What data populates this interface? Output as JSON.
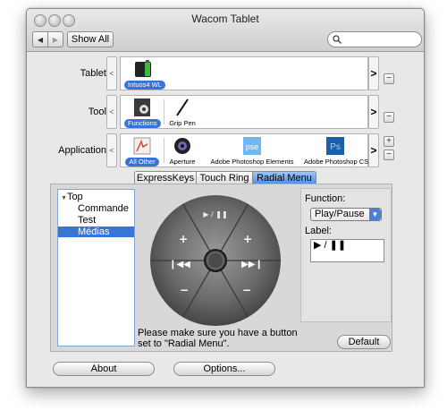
{
  "window": {
    "title": "Wacom Tablet"
  },
  "toolbar": {
    "back_glyph": "◀",
    "forward_glyph": "▶",
    "show_all_label": "Show All",
    "search_placeholder": ""
  },
  "rows": {
    "tablet": {
      "label": "Tablet:",
      "items": [
        {
          "name": "Intuos4 WL",
          "selected": true,
          "icon": "tablet-icon"
        }
      ]
    },
    "tool": {
      "label": "Tool:",
      "items": [
        {
          "name": "Functions",
          "selected": true,
          "icon": "functions-icon"
        },
        {
          "name": "Grip Pen",
          "selected": false,
          "icon": "pen-icon"
        }
      ]
    },
    "application": {
      "label": "Application:",
      "items": [
        {
          "name": "All Other",
          "selected": true,
          "icon": "all-other-icon"
        },
        {
          "name": "Aperture",
          "selected": false,
          "icon": "aperture-icon"
        },
        {
          "name": "Adobe Photoshop Elements",
          "selected": false,
          "icon": "pse-icon"
        },
        {
          "name": "Adobe Photoshop CSS",
          "selected": false,
          "icon": "ps-icon"
        }
      ]
    }
  },
  "badges": {
    "pse": "pse",
    "ps": "Ps"
  },
  "scroll": {
    "left": "<",
    "right": ">"
  },
  "controls": {
    "add": "+",
    "remove": "−"
  },
  "tabs": [
    {
      "label": "ExpressKeys",
      "selected": false
    },
    {
      "label": "Touch Ring",
      "selected": false
    },
    {
      "label": "Radial Menu",
      "selected": true
    }
  ],
  "tree": {
    "items": [
      {
        "label": "Top",
        "indent": 0,
        "expanded": true,
        "selected": false
      },
      {
        "label": "Commande",
        "indent": 1,
        "selected": false
      },
      {
        "label": "Test",
        "indent": 1,
        "selected": false
      },
      {
        "label": "Médias",
        "indent": 1,
        "selected": true
      }
    ]
  },
  "radial": {
    "top": "▶ / ❚❚",
    "left": "❙◀◀",
    "right": "▶▶❙",
    "upper_left": "+",
    "upper_right": "+",
    "lower_left": "−",
    "lower_right": "−"
  },
  "note": "Please make sure you have a button set to \"Radial Menu\".",
  "function_panel": {
    "function_label": "Function:",
    "selected_function": "Play/Pause",
    "label_label": "Label:",
    "label_value": "▶ / ❚❚"
  },
  "buttons": {
    "default": "Default",
    "about": "About",
    "options": "Options..."
  },
  "colors": {
    "accent": "#3874d7",
    "window_bg": "#e8e8e8"
  }
}
